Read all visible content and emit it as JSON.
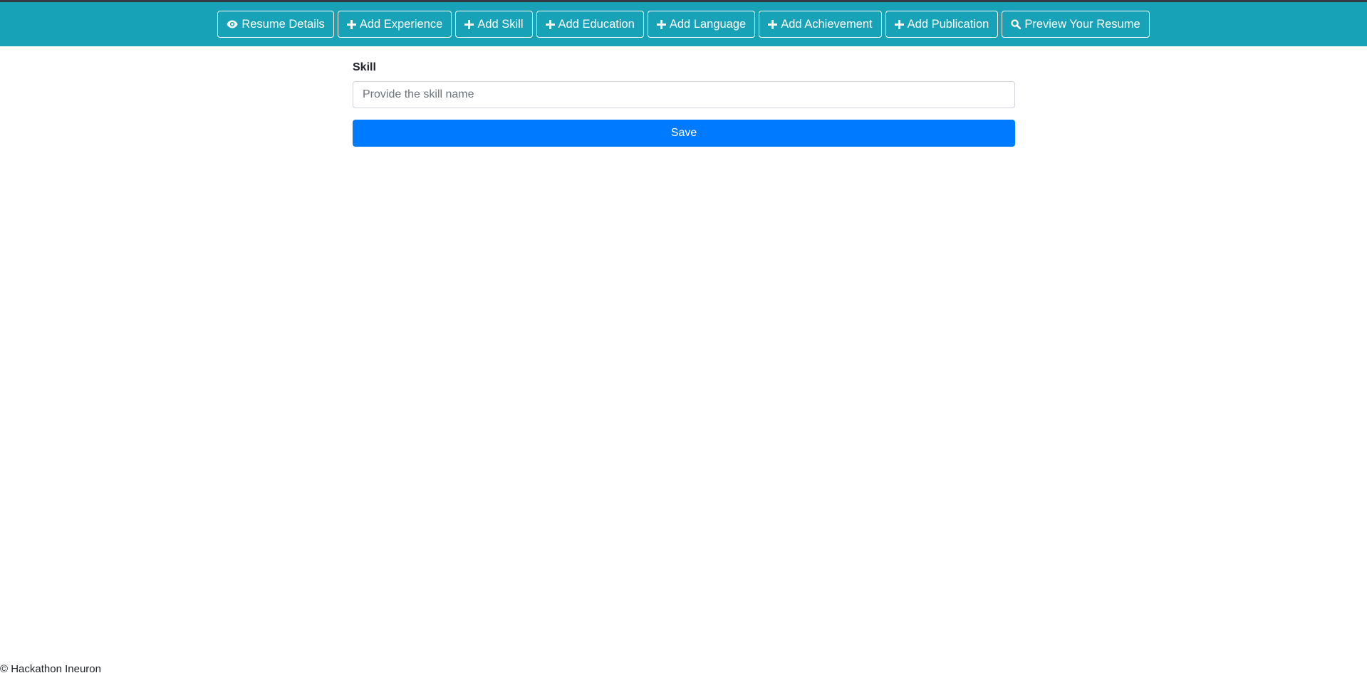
{
  "nav": {
    "buttons": [
      {
        "label": "Resume Details",
        "icon": "eye-icon"
      },
      {
        "label": "Add Experience",
        "icon": "plus-icon"
      },
      {
        "label": "Add Skill",
        "icon": "plus-icon"
      },
      {
        "label": "Add Education",
        "icon": "plus-icon"
      },
      {
        "label": "Add Language",
        "icon": "plus-icon"
      },
      {
        "label": "Add Achievement",
        "icon": "plus-icon"
      },
      {
        "label": "Add Publication",
        "icon": "plus-icon"
      },
      {
        "label": "Preview Your Resume",
        "icon": "search-icon"
      }
    ]
  },
  "form": {
    "skill_label": "Skill",
    "skill_value": "",
    "skill_placeholder": "Provide the skill name",
    "save_label": "Save"
  },
  "footer": {
    "text": "© Hackathon Ineuron"
  },
  "colors": {
    "navbar_bg": "#17a2b8",
    "primary_button": "#007bff",
    "top_line": "#343a40"
  }
}
